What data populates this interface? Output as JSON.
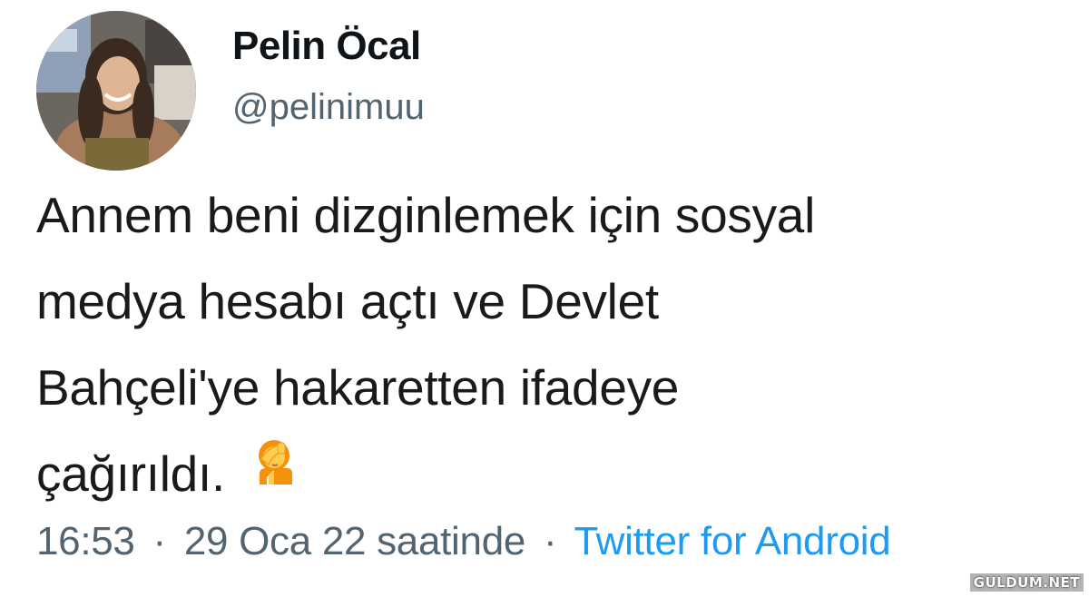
{
  "author": {
    "display_name": "Pelin Öcal",
    "handle": "@pelinimuu"
  },
  "tweet": {
    "lines": [
      "Annem beni dizginlemek için sosyal",
      "medya hesabı açtı ve Devlet",
      "Bahçeli'ye hakaretten ifadeye",
      "çağırıldı."
    ],
    "emoji": "woman-facepalming-emoji"
  },
  "meta": {
    "time": "16:53",
    "separator": "·",
    "date": "29 Oca 22 saatinde",
    "source": "Twitter for Android"
  },
  "colors": {
    "text": "#0f1419",
    "secondary": "#536471",
    "link": "#1d9bf0"
  },
  "watermark": "GULDUM.NET"
}
